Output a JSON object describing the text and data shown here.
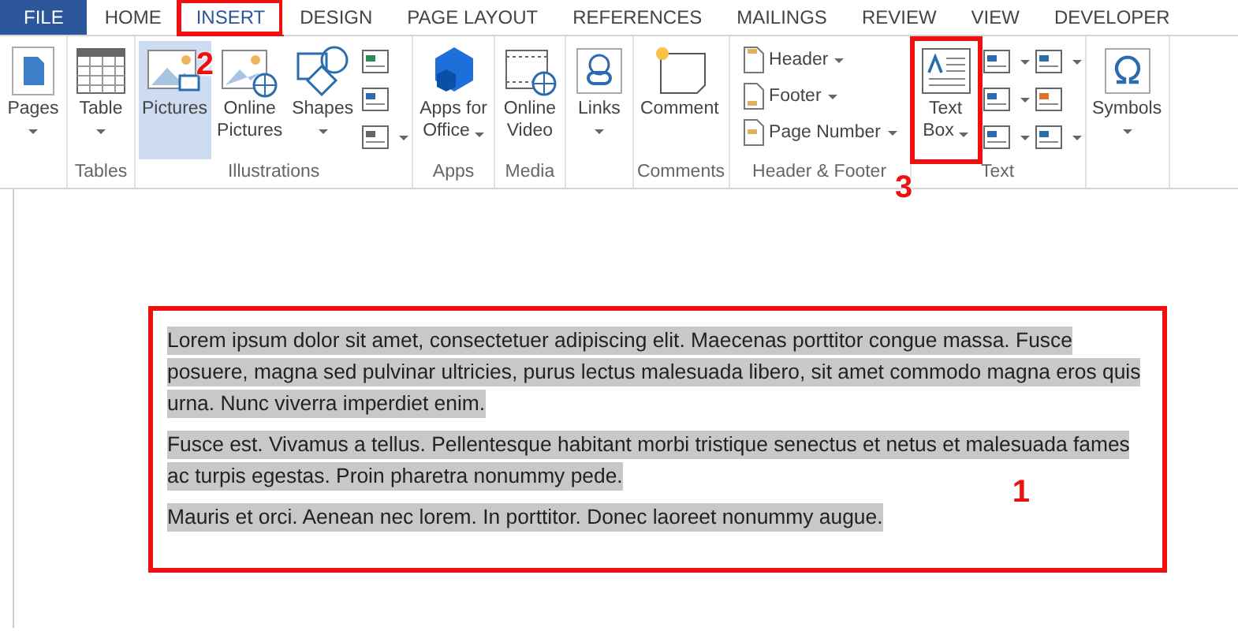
{
  "tabs": [
    {
      "label": "FILE",
      "kind": "file",
      "selected": false,
      "boxed": false
    },
    {
      "label": "HOME",
      "kind": "tab",
      "selected": false,
      "boxed": false
    },
    {
      "label": "INSERT",
      "kind": "tab",
      "selected": true,
      "boxed": true
    },
    {
      "label": "DESIGN",
      "kind": "tab",
      "selected": false,
      "boxed": false
    },
    {
      "label": "PAGE LAYOUT",
      "kind": "tab",
      "selected": false,
      "boxed": false
    },
    {
      "label": "REFERENCES",
      "kind": "tab",
      "selected": false,
      "boxed": false
    },
    {
      "label": "MAILINGS",
      "kind": "tab",
      "selected": false,
      "boxed": false
    },
    {
      "label": "REVIEW",
      "kind": "tab",
      "selected": false,
      "boxed": false
    },
    {
      "label": "VIEW",
      "kind": "tab",
      "selected": false,
      "boxed": false
    },
    {
      "label": "DEVELOPER",
      "kind": "tab",
      "selected": false,
      "boxed": false
    }
  ],
  "ribbon": [
    {
      "buttons": [
        {
          "kind": "large",
          "lines": [
            "Pages"
          ],
          "caret": true
        }
      ]
    },
    {
      "label": "Tables",
      "buttons": [
        {
          "kind": "large",
          "lines": [
            "Table"
          ],
          "caret": true
        }
      ]
    },
    {
      "label": "Illustrations",
      "buttons": [
        {
          "kind": "large",
          "lines": [
            "Pictures"
          ],
          "caret": false,
          "selected": true,
          "marker": "2"
        },
        {
          "kind": "large",
          "lines": [
            "Online",
            "Pictures"
          ],
          "caret": false
        },
        {
          "kind": "large",
          "lines": [
            "Shapes"
          ],
          "caret": true
        },
        {
          "kind": "stack",
          "items": [
            {
              "caret": false
            },
            {
              "caret": false
            },
            {
              "caret": true
            }
          ]
        }
      ]
    },
    {
      "label": "Apps",
      "buttons": [
        {
          "kind": "large",
          "lines": [
            "Apps for",
            "Office"
          ],
          "caret": true
        }
      ]
    },
    {
      "label": "Media",
      "buttons": [
        {
          "kind": "large",
          "lines": [
            "Online",
            "Video"
          ],
          "caret": false
        }
      ]
    },
    {
      "buttons": [
        {
          "kind": "large",
          "lines": [
            "Links"
          ],
          "caret": true
        }
      ]
    },
    {
      "label": "Comments",
      "buttons": [
        {
          "kind": "large",
          "lines": [
            "Comment"
          ],
          "caret": false
        }
      ]
    },
    {
      "label": "Header & Footer",
      "buttons": [
        {
          "kind": "list",
          "items": [
            {
              "label": "Header",
              "caret": true
            },
            {
              "label": "Footer",
              "caret": true
            },
            {
              "label": "Page Number",
              "caret": true
            }
          ]
        }
      ]
    },
    {
      "label": "Text",
      "buttons": [
        {
          "kind": "large",
          "lines": [
            "Text",
            "Box"
          ],
          "caret": true,
          "boxed": true,
          "marker": "3"
        },
        {
          "kind": "stack",
          "items": [
            {
              "caret": true
            },
            {
              "caret": true
            },
            {
              "caret": true
            }
          ]
        },
        {
          "kind": "stack",
          "items": [
            {
              "caret": true
            },
            {
              "caret": false
            },
            {
              "caret": true
            }
          ]
        }
      ]
    },
    {
      "buttons": [
        {
          "kind": "large",
          "lines": [
            "Symbols"
          ],
          "caret": true
        }
      ]
    }
  ],
  "document": {
    "boxed": true,
    "marker": "1",
    "paragraphs": [
      {
        "text": "Lorem ipsum dolor sit amet, consectetuer adipiscing elit. Maecenas porttitor congue massa. Fusce posuere, magna sed pulvinar ultricies, purus lectus malesuada libero, sit amet commodo magna eros quis urna. Nunc viverra imperdiet enim.",
        "selected": true
      },
      {
        "text": "Fusce est. Vivamus a tellus. Pellentesque habitant morbi tristique senectus et netus et malesuada fames ac turpis egestas. Proin pharetra nonummy pede.",
        "selected": true
      },
      {
        "text": "Mauris et orci. Aenean nec lorem. In porttitor. Donec laoreet nonummy augue.",
        "selected": true
      }
    ]
  }
}
